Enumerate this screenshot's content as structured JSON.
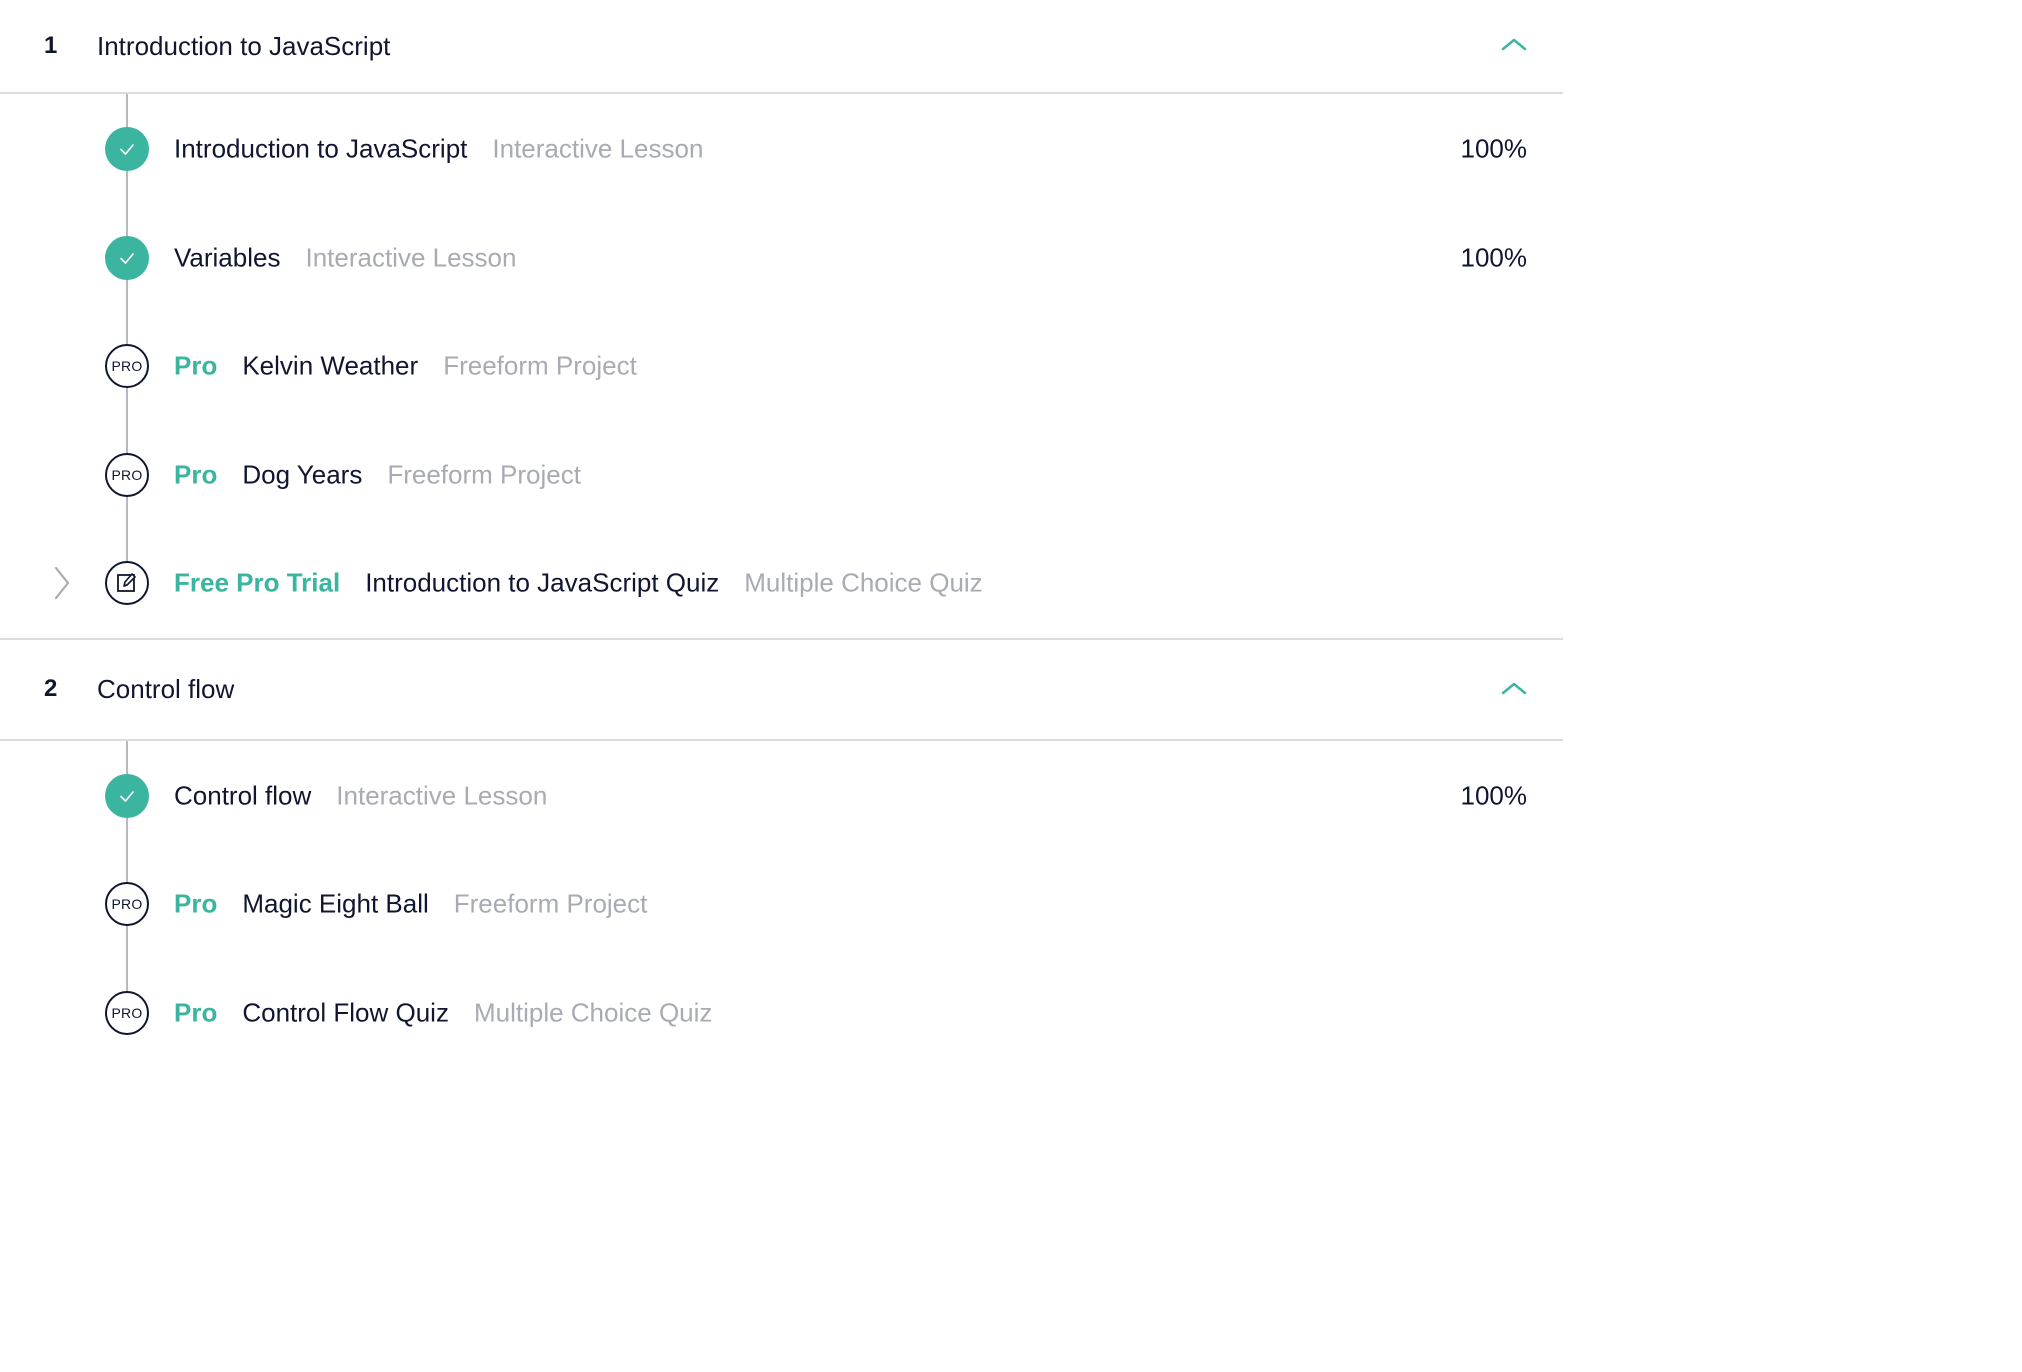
{
  "modules": [
    {
      "number": "1",
      "title": "Introduction to JavaScript",
      "items": [
        {
          "status": "complete",
          "badge": "",
          "title": "Introduction to JavaScript",
          "type": "Interactive Lesson",
          "progress": "100%"
        },
        {
          "status": "complete",
          "badge": "",
          "title": "Variables",
          "type": "Interactive Lesson",
          "progress": "100%"
        },
        {
          "status": "pro",
          "status_label": "PRO",
          "badge": "Pro",
          "title": "Kelvin Weather",
          "type": "Freeform Project",
          "progress": ""
        },
        {
          "status": "pro",
          "status_label": "PRO",
          "badge": "Pro",
          "title": "Dog Years",
          "type": "Freeform Project",
          "progress": ""
        },
        {
          "status": "quiz",
          "badge": "Free Pro Trial",
          "title": "Introduction to JavaScript Quiz",
          "type": "Multiple Choice Quiz",
          "progress": ""
        }
      ]
    },
    {
      "number": "2",
      "title": "Control flow",
      "items": [
        {
          "status": "complete",
          "badge": "",
          "title": "Control flow",
          "type": "Interactive Lesson",
          "progress": "100%"
        },
        {
          "status": "pro",
          "status_label": "PRO",
          "badge": "Pro",
          "title": "Magic Eight Ball",
          "type": "Freeform Project",
          "progress": ""
        },
        {
          "status": "pro",
          "status_label": "PRO",
          "badge": "Pro",
          "title": "Control Flow Quiz",
          "type": "Multiple Choice Quiz",
          "progress": ""
        }
      ]
    }
  ],
  "colors": {
    "accent": "#3bb5a0",
    "text": "#10162f",
    "muted": "#a9abb4",
    "divider": "#dcdde1"
  },
  "icons": {
    "complete": "check-icon",
    "pro": "pro-icon",
    "quiz": "quiz-edit-icon",
    "collapse": "chevron-up-icon",
    "expand": "chevron-right-icon"
  }
}
